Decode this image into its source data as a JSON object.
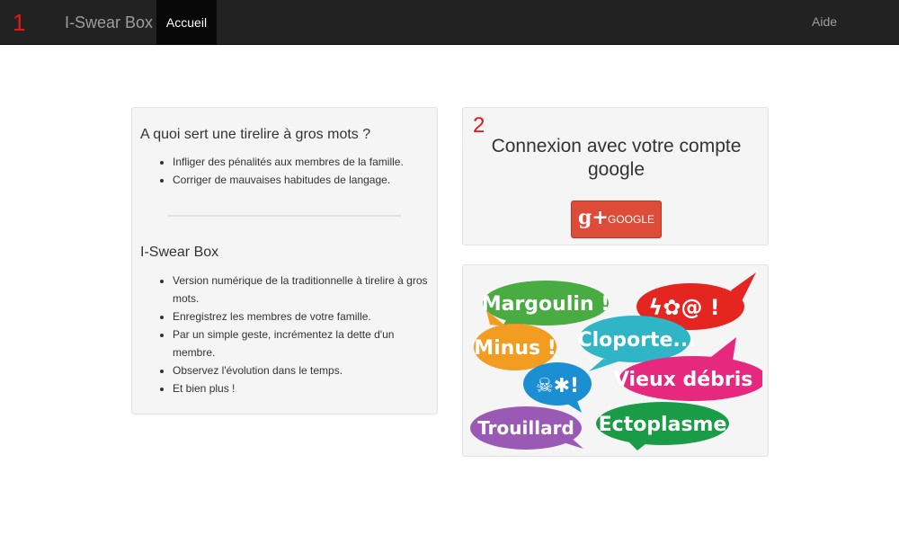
{
  "markers": {
    "one": "1",
    "two": "2"
  },
  "navbar": {
    "brand": "I-Swear Box",
    "active_tab": "Accueil",
    "help": "Aide"
  },
  "info_panel": {
    "section1_title": "A quoi sert une tirelire à gros mots ?",
    "section1_items": [
      "Infliger des pénalités aux membres de la famille.",
      "Corriger de mauvaises habitudes de langage."
    ],
    "section2_title": "I-Swear Box",
    "section2_items": [
      "Version numérique de la traditionnelle à tirelire à gros mots.",
      "Enregistrez les membres de votre famille.",
      "Par un simple geste, incrémentez la dette d'un membre.",
      "Observez l'évolution dans le temps.",
      "Et bien plus !"
    ]
  },
  "login_panel": {
    "title": "Connexion avec votre compte google",
    "google_icon": "g+",
    "google_button": "GOOGLE"
  },
  "illustration": {
    "bubbles": [
      {
        "text": "Margoulin !",
        "color": "#49ac42"
      },
      {
        "text": "Minus !",
        "color": "#f39c22"
      },
      {
        "text": "Cloporte...",
        "color": "#2fb5c6"
      },
      {
        "text": "Vieux débris !",
        "color": "#e6297f"
      },
      {
        "text": "Trouillard",
        "color": "#9b59b6"
      },
      {
        "text": "Ectoplasme",
        "color": "#1a9b45"
      }
    ]
  },
  "colors": {
    "navbar": "#222222",
    "google_button": "#dd4b39",
    "marker": "#e8141b"
  }
}
